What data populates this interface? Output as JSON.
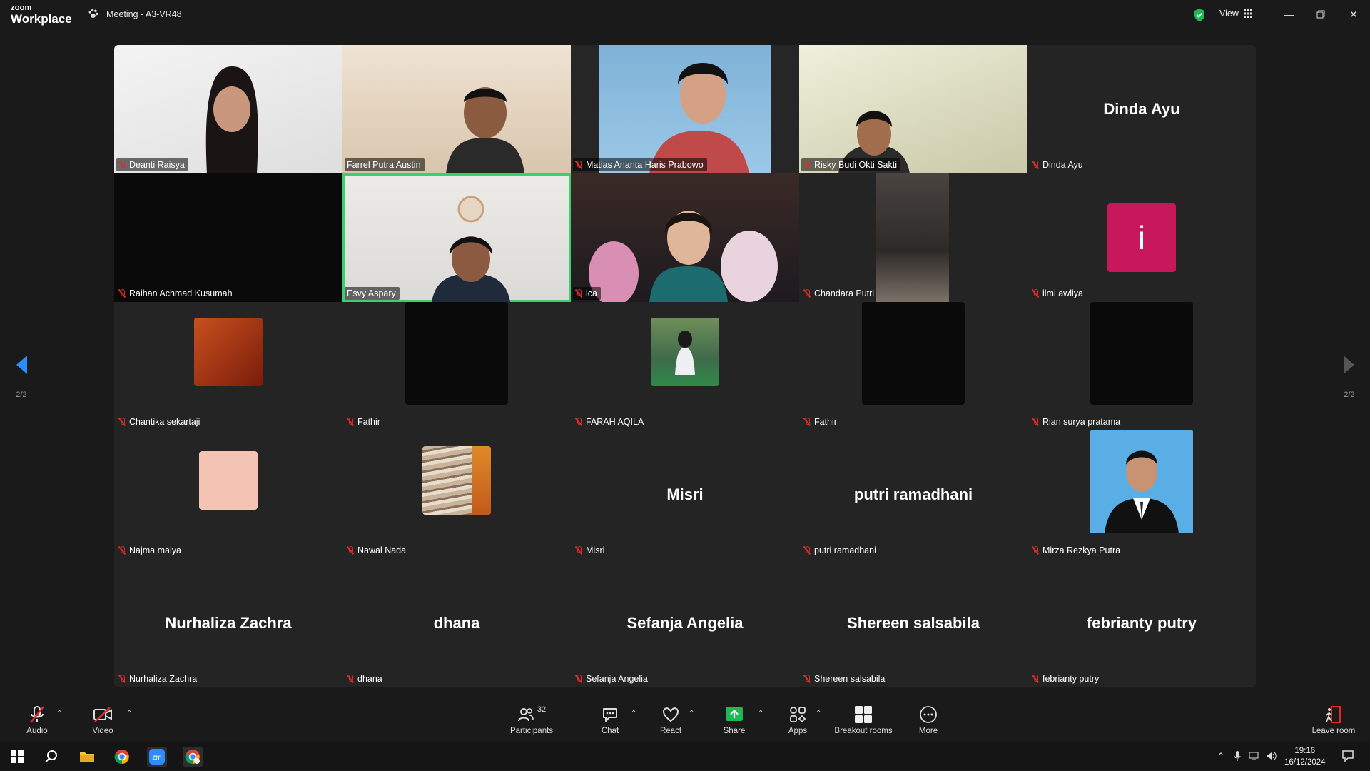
{
  "window": {
    "logo_small": "zoom",
    "logo_large": "Workplace",
    "meeting_title": "Meeting - A3-VR48",
    "view_label": "View"
  },
  "pagination": {
    "left": "2/2",
    "right": "2/2"
  },
  "participants": [
    {
      "name": "Deanti Raisya",
      "kind": "video",
      "big": ""
    },
    {
      "name": "Farrel Putra Austin",
      "kind": "video",
      "big": ""
    },
    {
      "name": "Matias Ananta Haris Prabowo",
      "kind": "video",
      "big": ""
    },
    {
      "name": "Risky Budi Okti Sakti",
      "kind": "video",
      "big": ""
    },
    {
      "name": "Dinda Ayu",
      "kind": "name",
      "big": "Dinda Ayu"
    },
    {
      "name": "Raihan Achmad Kusumah",
      "kind": "video",
      "big": ""
    },
    {
      "name": "Esvy Aspary",
      "kind": "video",
      "big": ""
    },
    {
      "name": "ica",
      "kind": "video",
      "big": ""
    },
    {
      "name": "Chandara Putri",
      "kind": "video",
      "big": ""
    },
    {
      "name": "ilmi awliya",
      "kind": "avatar",
      "big": "i"
    },
    {
      "name": "Chantika sekartaji",
      "kind": "avatar",
      "big": ""
    },
    {
      "name": "Fathir",
      "kind": "avatar",
      "big": ""
    },
    {
      "name": "FARAH AQILA",
      "kind": "avatar",
      "big": ""
    },
    {
      "name": "Fathir",
      "kind": "avatar",
      "big": ""
    },
    {
      "name": "Rian surya pratama",
      "kind": "avatar",
      "big": ""
    },
    {
      "name": "Najma malya",
      "kind": "avatar",
      "big": ""
    },
    {
      "name": "Nawal Nada",
      "kind": "avatar",
      "big": ""
    },
    {
      "name": "Misri",
      "kind": "name",
      "big": "Misri"
    },
    {
      "name": "putri ramadhani",
      "kind": "name",
      "big": "putri ramadhani"
    },
    {
      "name": "Mirza Rezkya Putra",
      "kind": "avatar",
      "big": ""
    },
    {
      "name": "Nurhaliza Zachra",
      "kind": "name",
      "big": "Nurhaliza Zachra"
    },
    {
      "name": "dhana",
      "kind": "name",
      "big": "dhana"
    },
    {
      "name": "Sefanja Angelia",
      "kind": "name",
      "big": "Sefanja Angelia"
    },
    {
      "name": "Shereen salsabila",
      "kind": "name",
      "big": "Shereen salsabila"
    },
    {
      "name": "febrianty putry",
      "kind": "name",
      "big": "febrianty putry"
    }
  ],
  "toolbar": {
    "audio": "Audio",
    "video": "Video",
    "participants": "Participants",
    "participants_count": "32",
    "chat": "Chat",
    "react": "React",
    "share": "Share",
    "apps": "Apps",
    "breakout": "Breakout rooms",
    "more": "More",
    "leave": "Leave room"
  },
  "taskbar": {
    "time": "19:16",
    "date": "16/12/2024"
  },
  "colors": {
    "accent_green": "#3ad06f",
    "share_green": "#1db954",
    "mute_red": "#e02a2a",
    "avatar_ilmi": "#c8185c"
  }
}
